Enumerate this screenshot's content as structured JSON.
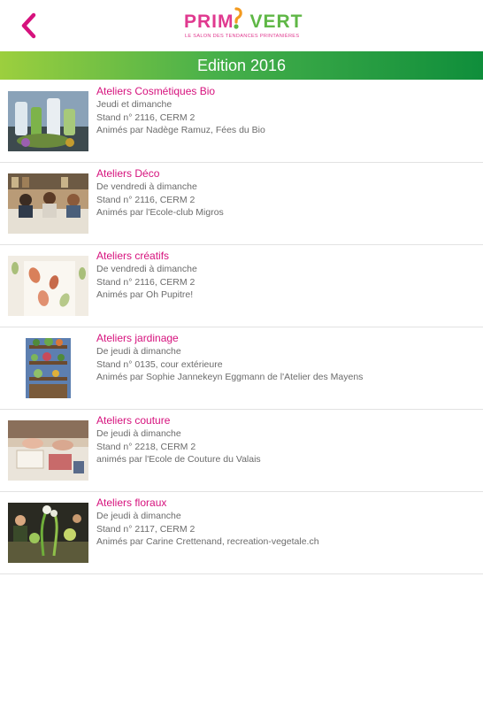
{
  "header": {
    "back_icon": "chevron-left-icon",
    "logo": {
      "word_left": "PRIM",
      "word_right": "VERT",
      "tagline": "LE SALON DES TENDANCES PRINTANIÈRES"
    }
  },
  "banner": {
    "title": "Edition 2016"
  },
  "colors": {
    "accent_pink": "#d6127d",
    "logo_pink": "#e0398f",
    "logo_green": "#5fb746",
    "banner_green_light": "#9ccf3e",
    "banner_green_dark": "#0f8e3b",
    "body_text": "#6b6b6b",
    "divider": "#e2e2e2"
  },
  "items": [
    {
      "title": "Ateliers Cosmétiques Bio",
      "when": "Jeudi et dimanche",
      "stand": "Stand n° 2116, CERM 2",
      "by": "Animés par Nadège Ramuz, Fées du Bio",
      "thumb": "cosmetics-bottles-photo"
    },
    {
      "title": "Ateliers Déco",
      "when": "De vendredi à dimanche",
      "stand": "Stand n° 2116, CERM 2",
      "by": "Animés par l'Ecole-club Migros",
      "thumb": "workshop-table-photo"
    },
    {
      "title": "Ateliers créatifs",
      "when": "De vendredi à dimanche",
      "stand": "Stand n° 2116, CERM 2",
      "by": "Animés par Oh Pupitre!",
      "thumb": "fabric-leaves-photo"
    },
    {
      "title": "Ateliers jardinage",
      "when": "De jeudi à dimanche",
      "stand": "Stand n° 0135, cour extérieure",
      "by": "Animés par Sophie Jannekeyn Eggmann de l'Atelier des Mayens",
      "thumb": "garden-shelf-photo"
    },
    {
      "title": "Ateliers couture",
      "when": "De jeudi à dimanche",
      "stand": "Stand n° 2218, CERM 2",
      "by": "animés par l'Ecole de Couture du Valais",
      "thumb": "sewing-table-photo"
    },
    {
      "title": "Ateliers floraux",
      "when": "De jeudi à dimanche",
      "stand": "Stand n° 2117, CERM 2",
      "by": "Animés par Carine Crettenand, recreation-vegetale.ch",
      "thumb": "flower-arranging-photo"
    }
  ]
}
